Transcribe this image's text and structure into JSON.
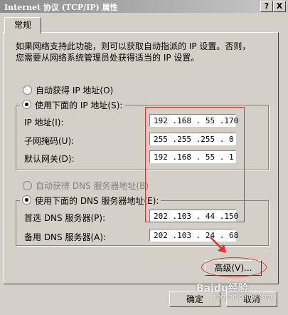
{
  "window": {
    "title": "Internet 协议 (TCP/IP) 属性",
    "help_label": "?",
    "close_label": "X"
  },
  "tabs": [
    {
      "label": "常规"
    }
  ],
  "description": {
    "line1": "如果网络支持此功能，则可以获取自动指派的 IP 设置。否则，",
    "line2": "您需要从网络系统管理员处获得适当的 IP 设置。"
  },
  "ip_mode": {
    "auto_label": "自动获得 IP 地址(O)",
    "manual_label": "使用下面的 IP 地址(S):",
    "selected": "manual"
  },
  "ip_fields": [
    {
      "label": "IP 地址(I):",
      "value": "192 .168 . 55 .170"
    },
    {
      "label": "子网掩码(U):",
      "value": "255 .255 .255 . 0"
    },
    {
      "label": "默认网关(D):",
      "value": "192 .168 . 55 . 1"
    }
  ],
  "dns_mode": {
    "auto_label": "自动获得 DNS 服务器地址(B)",
    "manual_label": "使用下面的 DNS 服务器地址(E):",
    "selected": "manual"
  },
  "dns_fields": [
    {
      "label": "首选 DNS 服务器(P):",
      "value": "202 .103 . 44 .150"
    },
    {
      "label": "备用 DNS 服务器(A):",
      "value": "202 .103 . 24 . 68"
    }
  ],
  "buttons": {
    "advanced": "高级(V)...",
    "ok": "确定",
    "cancel": "取消"
  },
  "watermark": {
    "line1": "Baidu经验",
    "line2": "jingyan.baidu.com"
  },
  "colors": {
    "annotation": "#e03030",
    "dialog_bg": "#d4d0c8"
  }
}
